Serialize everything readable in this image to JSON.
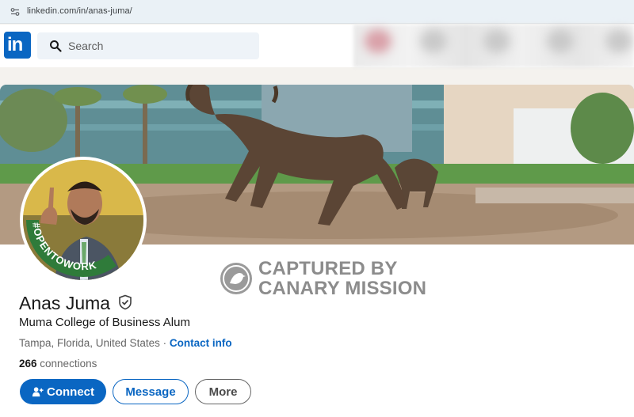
{
  "browser": {
    "url": "linkedin.com/in/anas-juma/"
  },
  "nav": {
    "search_placeholder": "Search",
    "logo_text": "in"
  },
  "watermark": {
    "line1": "CAPTURED BY",
    "line2": "CANARY MISSION"
  },
  "avatar": {
    "badge_text": "#OPENTOWORK"
  },
  "profile": {
    "name": "Anas Juma",
    "headline": "Muma College of Business Alum",
    "location": "Tampa, Florida, United States",
    "separator": " · ",
    "contact_info": "Contact info",
    "connections_count": "266",
    "connections_label": " connections"
  },
  "actions": {
    "connect": "Connect",
    "message": "Message",
    "more": "More"
  },
  "colors": {
    "brand": "#0a66c2",
    "open_to_work": "#2f7b3a"
  }
}
